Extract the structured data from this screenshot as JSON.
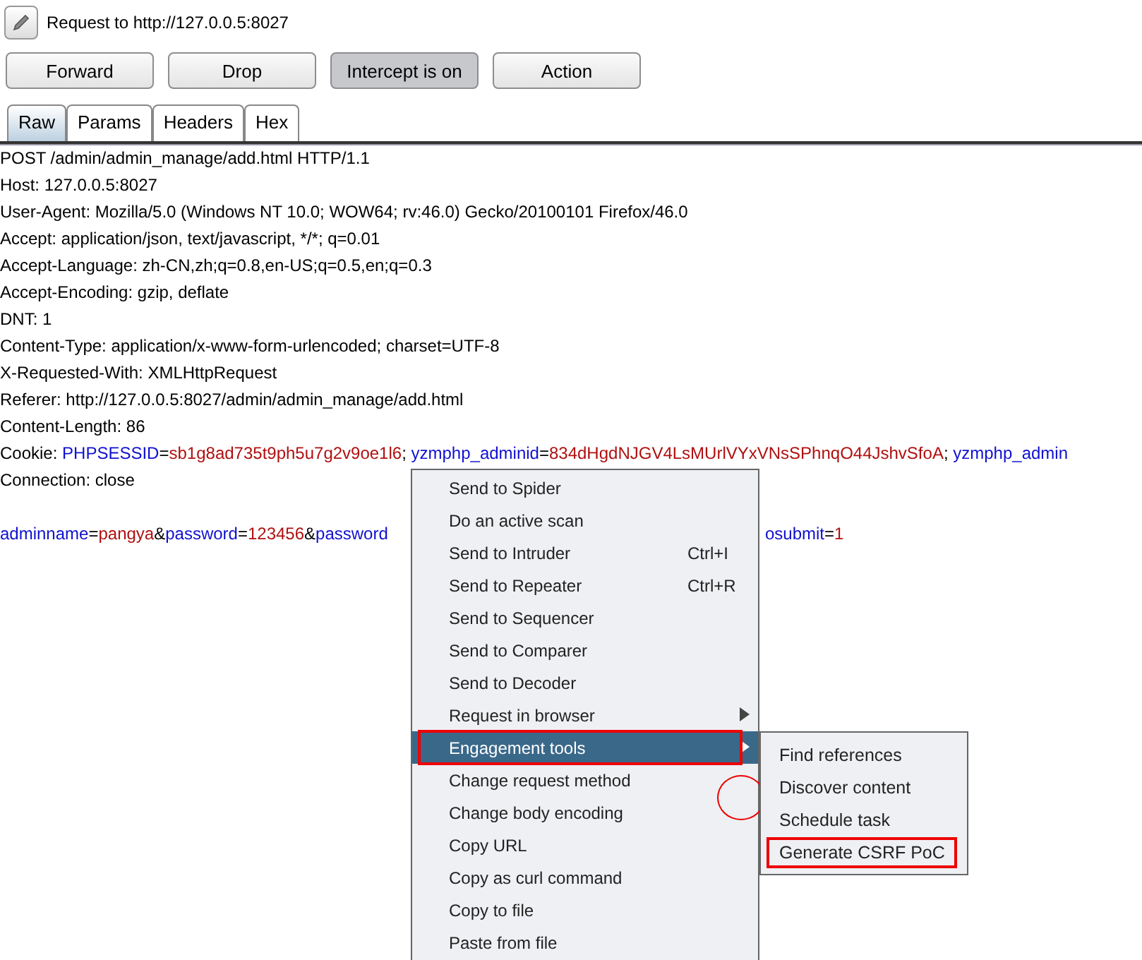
{
  "header": {
    "title": "Request to http://127.0.0.5:8027"
  },
  "buttons": [
    {
      "label": "Forward",
      "pressed": false
    },
    {
      "label": "Drop",
      "pressed": false
    },
    {
      "label": "Intercept is on",
      "pressed": true
    },
    {
      "label": "Action",
      "pressed": false
    }
  ],
  "tabs": [
    {
      "label": "Raw",
      "selected": true
    },
    {
      "label": "Params",
      "selected": false
    },
    {
      "label": "Headers",
      "selected": false
    },
    {
      "label": "Hex",
      "selected": false
    }
  ],
  "request_lines": [
    [
      {
        "t": "POST /admin/admin_manage/add.html HTTP/1.1",
        "kind": "plain"
      }
    ],
    [
      {
        "t": "Host: 127.0.0.5:8027",
        "kind": "plain"
      }
    ],
    [
      {
        "t": "User-Agent: Mozilla/5.0 (Windows NT 10.0; WOW64; rv:46.0) Gecko/20100101 Firefox/46.0",
        "kind": "plain"
      }
    ],
    [
      {
        "t": "Accept: application/json, text/javascript, */*; q=0.01",
        "kind": "plain"
      }
    ],
    [
      {
        "t": "Accept-Language: zh-CN,zh;q=0.8,en-US;q=0.5,en;q=0.3",
        "kind": "plain"
      }
    ],
    [
      {
        "t": "Accept-Encoding: gzip, deflate",
        "kind": "plain"
      }
    ],
    [
      {
        "t": "DNT: 1",
        "kind": "plain"
      }
    ],
    [
      {
        "t": "Content-Type: application/x-www-form-urlencoded; charset=UTF-8",
        "kind": "plain"
      }
    ],
    [
      {
        "t": "X-Requested-With: XMLHttpRequest",
        "kind": "plain"
      }
    ],
    [
      {
        "t": "Referer: http://127.0.0.5:8027/admin/admin_manage/add.html",
        "kind": "plain"
      }
    ],
    [
      {
        "t": "Content-Length: 86",
        "kind": "plain"
      }
    ],
    [
      {
        "t": "Cookie: ",
        "kind": "plain"
      },
      {
        "t": "PHPSESSID",
        "kind": "key"
      },
      {
        "t": "=",
        "kind": "plain"
      },
      {
        "t": "sb1g8ad735t9ph5u7g2v9oe1l6",
        "kind": "value"
      },
      {
        "t": "; ",
        "kind": "plain"
      },
      {
        "t": "yzmphp_adminid",
        "kind": "key"
      },
      {
        "t": "=",
        "kind": "plain"
      },
      {
        "t": "834dHgdNJGV4LsMUrlVYxVNsSPhnqO44JshvSfoA",
        "kind": "value"
      },
      {
        "t": "; ",
        "kind": "plain"
      },
      {
        "t": "yzmphp_admin",
        "kind": "key"
      }
    ],
    [
      {
        "t": "Connection: close",
        "kind": "plain"
      }
    ]
  ],
  "request_body": {
    "left": [
      {
        "t": "adminname",
        "kind": "key"
      },
      {
        "t": "=",
        "kind": "plain"
      },
      {
        "t": "pangya",
        "kind": "value"
      },
      {
        "t": "&",
        "kind": "plain"
      },
      {
        "t": "password",
        "kind": "key"
      },
      {
        "t": "=",
        "kind": "plain"
      },
      {
        "t": "123456",
        "kind": "value"
      },
      {
        "t": "&",
        "kind": "plain"
      },
      {
        "t": "password",
        "kind": "key"
      }
    ],
    "right": [
      {
        "t": "osubmit",
        "kind": "key"
      },
      {
        "t": "=",
        "kind": "plain"
      },
      {
        "t": "1",
        "kind": "value"
      }
    ]
  },
  "context_menu": [
    {
      "label": "Send to Spider",
      "selected": false,
      "submenu": false,
      "annotated": false
    },
    {
      "label": "Do an active scan",
      "selected": false,
      "submenu": false,
      "annotated": false
    },
    {
      "label": "Send to Intruder",
      "shortcut": "Ctrl+I",
      "selected": false,
      "submenu": false,
      "annotated": false
    },
    {
      "label": "Send to Repeater",
      "shortcut": "Ctrl+R",
      "selected": false,
      "submenu": false,
      "annotated": false
    },
    {
      "label": "Send to Sequencer",
      "selected": false,
      "submenu": false,
      "annotated": false
    },
    {
      "label": "Send to Comparer",
      "selected": false,
      "submenu": false,
      "annotated": false
    },
    {
      "label": "Send to Decoder",
      "selected": false,
      "submenu": false,
      "annotated": false
    },
    {
      "label": "Request in browser",
      "selected": false,
      "submenu": true,
      "annotated": false
    },
    {
      "label": "Engagement tools",
      "selected": true,
      "submenu": true,
      "annotated": true
    },
    {
      "label": "Change request method",
      "selected": false,
      "submenu": false,
      "annotated": false
    },
    {
      "label": "Change body encoding",
      "selected": false,
      "submenu": false,
      "annotated": false
    },
    {
      "label": "Copy URL",
      "selected": false,
      "submenu": false,
      "annotated": false
    },
    {
      "label": "Copy as curl command",
      "selected": false,
      "submenu": false,
      "annotated": false
    },
    {
      "label": "Copy to file",
      "selected": false,
      "submenu": false,
      "annotated": false
    },
    {
      "label": "Paste from file",
      "selected": false,
      "submenu": false,
      "annotated": false
    }
  ],
  "submenu": [
    {
      "label": "Find references",
      "annotated": false
    },
    {
      "label": "Discover content",
      "annotated": false
    },
    {
      "label": "Schedule task",
      "annotated": false
    },
    {
      "label": "Generate CSRF PoC",
      "annotated": true
    }
  ]
}
